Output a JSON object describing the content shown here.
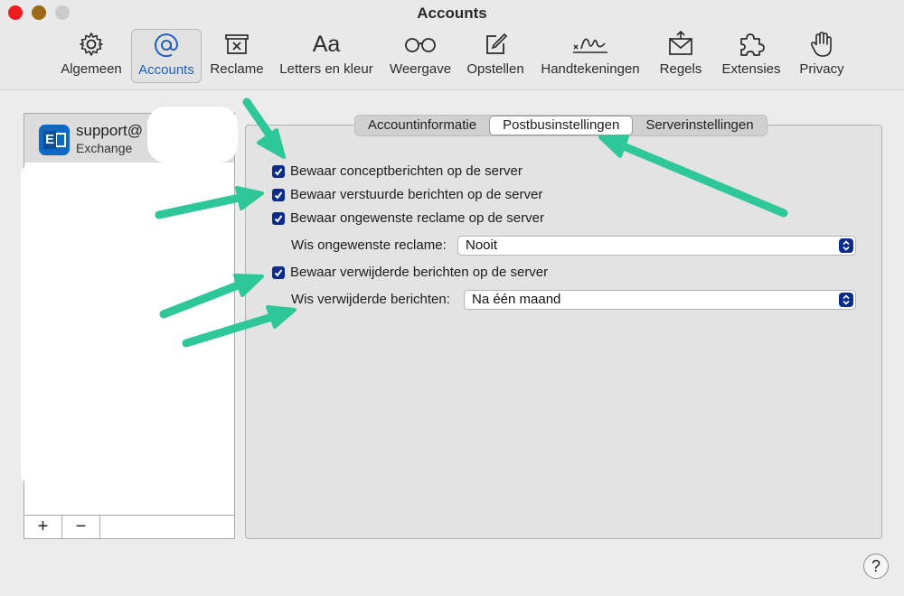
{
  "window": {
    "title": "Accounts"
  },
  "toolbar": {
    "items": [
      {
        "label": "Algemeen",
        "icon": "gear-icon"
      },
      {
        "label": "Accounts",
        "icon": "at-icon",
        "active": true
      },
      {
        "label": "Reclame",
        "icon": "junk-icon"
      },
      {
        "label": "Letters en kleur",
        "icon": "font-icon"
      },
      {
        "label": "Weergave",
        "icon": "glasses-icon"
      },
      {
        "label": "Opstellen",
        "icon": "compose-icon"
      },
      {
        "label": "Handtekeningen",
        "icon": "signature-icon"
      },
      {
        "label": "Regels",
        "icon": "rules-icon"
      },
      {
        "label": "Extensies",
        "icon": "puzzle-icon"
      },
      {
        "label": "Privacy",
        "icon": "hand-icon"
      }
    ]
  },
  "sidebar": {
    "account": {
      "name": "support@",
      "type": "Exchange"
    },
    "add_label": "+",
    "remove_label": "−"
  },
  "tabs": [
    {
      "label": "Accountinformatie"
    },
    {
      "label": "Postbusinstellingen",
      "selected": true
    },
    {
      "label": "Serverinstellingen"
    }
  ],
  "settings": {
    "drafts": {
      "label": "Bewaar conceptberichten op de server",
      "checked": true
    },
    "sent": {
      "label": "Bewaar verstuurde berichten op de server",
      "checked": true
    },
    "junk": {
      "label": "Bewaar ongewenste reclame op de server",
      "checked": true
    },
    "junk_erase": {
      "label": "Wis ongewenste reclame:",
      "value": "Nooit"
    },
    "deleted": {
      "label": "Bewaar verwijderde berichten op de server",
      "checked": true
    },
    "deleted_erase": {
      "label": "Wis verwijderde berichten:",
      "value": "Na één maand"
    }
  },
  "help": {
    "label": "?"
  },
  "colors": {
    "accent": "#1f5fbf",
    "checkbox": "#0d2b8c",
    "annotation_arrow": "#2ec79a"
  }
}
